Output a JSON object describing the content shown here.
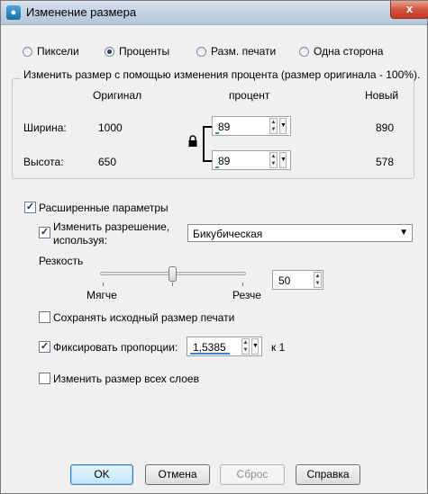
{
  "window": {
    "title": "Изменение размера",
    "close_glyph": "x"
  },
  "mode": {
    "options": [
      {
        "label": "Пиксели",
        "selected": false
      },
      {
        "label": "Проценты",
        "selected": true
      },
      {
        "label": "Разм. печати",
        "selected": false
      },
      {
        "label": "Одна сторона",
        "selected": false
      }
    ]
  },
  "resize": {
    "description": "Изменить размер с помощью изменения процента (размер оригинала - 100%).",
    "col_original": "Оригинал",
    "col_percent": "процент",
    "col_new": "Новый",
    "width_label": "Ширина:",
    "width_original": "1000",
    "width_percent": "89",
    "width_new": "890",
    "height_label": "Высота:",
    "height_original": "650",
    "height_percent": "89",
    "height_new": "578",
    "lock_icon": "lock-icon"
  },
  "advanced": {
    "label": "Расширенные параметры",
    "checked": true,
    "resample_label_line1": "Изменить разрешение,",
    "resample_label_line2": "используя:",
    "resample_checked": true,
    "resample_method": "Бикубическая",
    "sharpness_label": "Резкость",
    "sharpness_min_label": "Мягче",
    "sharpness_max_label": "Резче",
    "sharpness_value": "50",
    "keep_print_size_label": "Сохранять исходный размер печати",
    "keep_print_size_checked": false,
    "lock_ratio_label": "Фиксировать пропорции:",
    "lock_ratio_checked": true,
    "ratio_value": "1,5385",
    "ratio_suffix": "к 1",
    "all_layers_label": "Изменить размер всех слоев",
    "all_layers_checked": false
  },
  "buttons": {
    "ok": "OK",
    "cancel": "Отмена",
    "reset": "Сброс",
    "help": "Справка"
  },
  "colors": {
    "accent": "#3c7fd1",
    "titlebar": "#c4d2e0",
    "close": "#c33b22"
  }
}
